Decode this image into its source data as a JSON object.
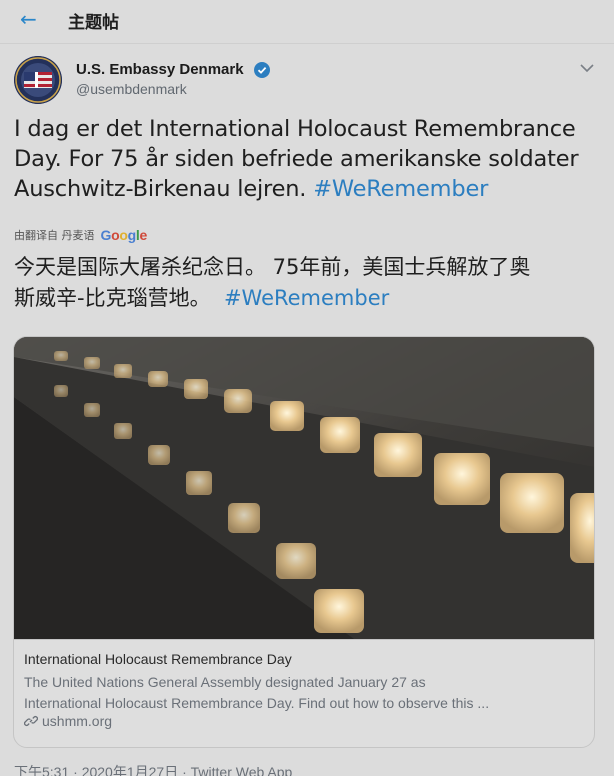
{
  "header": {
    "title": "主题帖"
  },
  "tweet": {
    "author_name": "U.S. Embassy Denmark",
    "author_handle": "@usembdenmark",
    "text_lines": [
      "I dag er det International Holocaust Remembrance",
      "Day. For 75 år siden befriede amerikanske soldater",
      "Auschwitz-Birkenau lejren."
    ],
    "hashtag": "#WeRemember",
    "translation_label": "由翻译自 丹麦语",
    "translation_provider": "Google",
    "translated_lines": [
      "今天是国际大屠杀纪念日。 75年前，美国士兵解放了奥",
      "斯威辛-比克瑙营地。"
    ],
    "translated_hashtag": "#WeRemember"
  },
  "card": {
    "title": "International Holocaust Remembrance Day",
    "description_lines": [
      "The United Nations General Assembly designated January 27 as",
      "International Holocaust Remembrance Day. Find out how to observe this ..."
    ],
    "domain": "ushmm.org"
  },
  "meta": {
    "timestamp": "下午5:31 · 2020年1月27日 · Twitter Web App"
  },
  "icons": {
    "back": "back-arrow-icon",
    "verified": "verified-badge-icon",
    "more": "chevron-down-icon",
    "link": "link-icon"
  },
  "colors": {
    "accent": "#2c7ec0",
    "background": "#dcdcdc"
  }
}
